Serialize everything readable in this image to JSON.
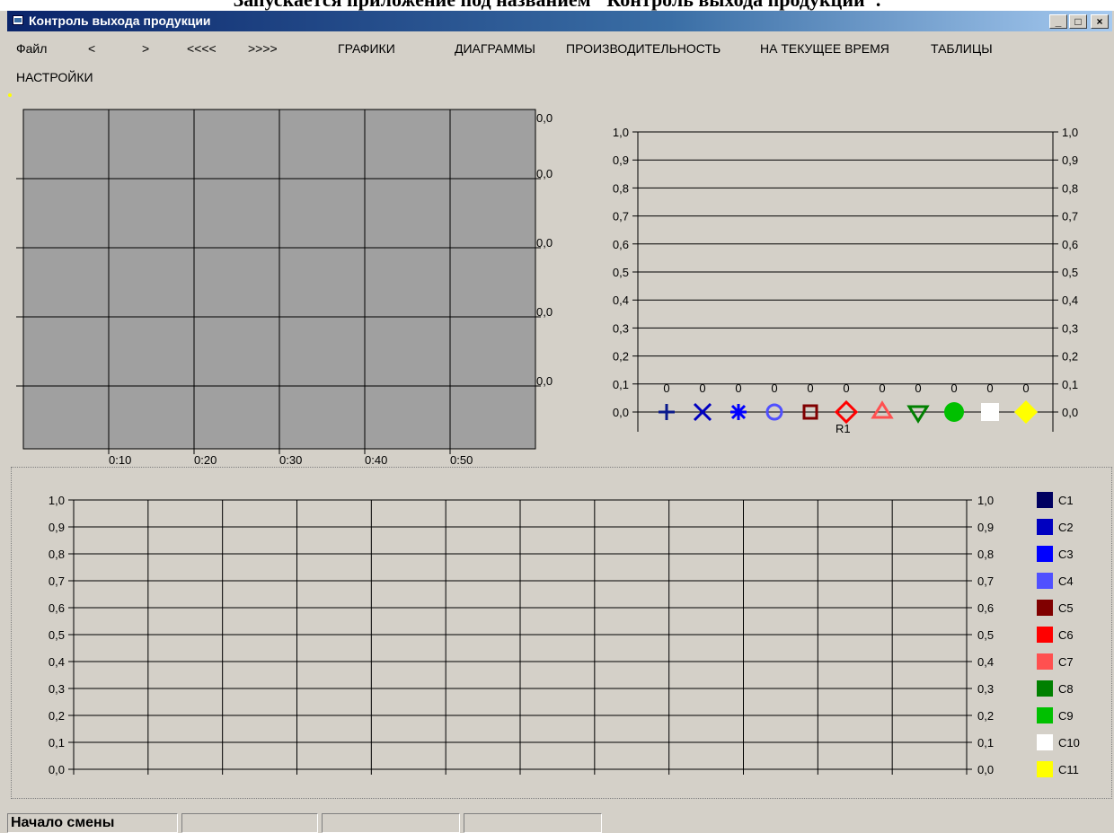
{
  "heading": "Запускается приложение под названием \"Контроль выхода продукции\".",
  "window": {
    "title": "Контроль выхода продукции"
  },
  "titlebar_buttons": {
    "minimize": "_",
    "maximize": "□",
    "close": "×"
  },
  "menu": [
    "Файл",
    "<",
    ">",
    "<<<<",
    ">>>>",
    "ГРАФИКИ",
    "ДИАГРАММЫ",
    "ПРОИЗВОДИТЕЛЬНОСТЬ",
    "НА ТЕКУЩЕЕ ВРЕМЯ",
    "ТАБЛИЦЫ",
    "НАСТРОЙКИ"
  ],
  "chart_data": [
    {
      "type": "line",
      "x_tick_labels": [
        "0:10",
        "0:20",
        "0:30",
        "0:40",
        "0:50"
      ],
      "y_tick_labels": [
        "0,0",
        "0,0",
        "0,0",
        "0,0",
        "0,0"
      ],
      "series": [],
      "grid": true,
      "background": "#a0a0a0"
    },
    {
      "type": "scatter",
      "ylim": [
        0,
        1
      ],
      "y_tick_labels": [
        "1,0",
        "0,9",
        "0,8",
        "0,7",
        "0,6",
        "0,5",
        "0,4",
        "0,3",
        "0,2",
        "0,1",
        "0,0"
      ],
      "categories": [
        "R1"
      ],
      "series": [
        {
          "marker": "plus",
          "color": "#0a1a8c",
          "value": 0
        },
        {
          "marker": "cross",
          "color": "#0000c0",
          "value": 0
        },
        {
          "marker": "asterisk",
          "color": "#0000ff",
          "value": 0
        },
        {
          "marker": "circle",
          "color": "#5050ff",
          "value": 0
        },
        {
          "marker": "square",
          "color": "#800000",
          "value": 0
        },
        {
          "marker": "diamond",
          "color": "#ff0000",
          "value": 0
        },
        {
          "marker": "triangle-up",
          "color": "#ff5050",
          "value": 0
        },
        {
          "marker": "triangle-down",
          "color": "#008000",
          "value": 0
        },
        {
          "marker": "filled-circle",
          "color": "#00c000",
          "value": 0
        },
        {
          "marker": "filled-square",
          "color": "#ffffff",
          "value": 0
        },
        {
          "marker": "filled-diamond",
          "color": "#ffff00",
          "value": 0
        }
      ],
      "data_labels": [
        "0",
        "0",
        "0",
        "0",
        "0",
        "0",
        "0",
        "0",
        "0",
        "0",
        "0"
      ],
      "grid": true
    },
    {
      "type": "line",
      "ylim": [
        0,
        1
      ],
      "y_tick_labels": [
        "1,0",
        "0,9",
        "0,8",
        "0,7",
        "0,6",
        "0,5",
        "0,4",
        "0,3",
        "0,2",
        "0,1",
        "0,0"
      ],
      "series": [
        {
          "name": "C1",
          "color": "#000060",
          "values": []
        },
        {
          "name": "C2",
          "color": "#0000c0",
          "values": []
        },
        {
          "name": "C3",
          "color": "#0000ff",
          "values": []
        },
        {
          "name": "C4",
          "color": "#5050ff",
          "values": []
        },
        {
          "name": "C5",
          "color": "#800000",
          "values": []
        },
        {
          "name": "C6",
          "color": "#ff0000",
          "values": []
        },
        {
          "name": "C7",
          "color": "#ff5050",
          "values": []
        },
        {
          "name": "C8",
          "color": "#008000",
          "values": []
        },
        {
          "name": "C9",
          "color": "#00c000",
          "values": []
        },
        {
          "name": "C10",
          "color": "#ffffff",
          "values": []
        },
        {
          "name": "C11",
          "color": "#ffff00",
          "values": []
        }
      ],
      "grid": true,
      "legend": "right"
    }
  ],
  "status": [
    "Начало смены",
    "",
    "",
    ""
  ]
}
